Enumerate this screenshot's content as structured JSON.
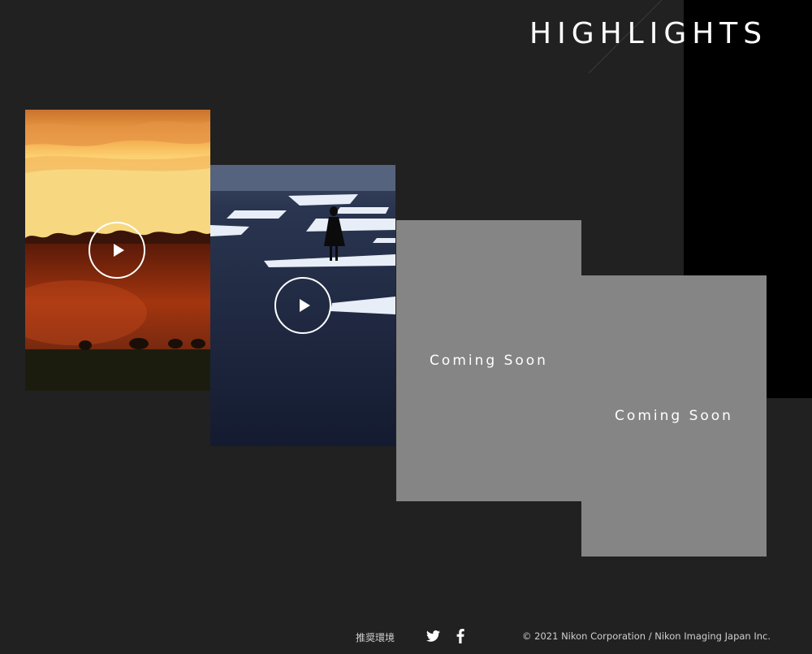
{
  "header": {
    "title": "HIGHLIGHTS"
  },
  "cards": [
    {
      "type": "video",
      "icon": "play-icon",
      "image": "sunset-savanna-elephants"
    },
    {
      "type": "video",
      "icon": "play-icon",
      "image": "person-on-illuminated-floor"
    },
    {
      "type": "placeholder",
      "label": "Coming Soon"
    },
    {
      "type": "placeholder",
      "label": "Coming Soon"
    }
  ],
  "footer": {
    "recommended_env": "推奨環境",
    "twitter_icon": "twitter-icon",
    "facebook_icon": "facebook-icon",
    "copyright": "© 2021 Nikon Corporation / Nikon Imaging Japan Inc."
  },
  "colors": {
    "background": "#212121",
    "panel": "#000000",
    "placeholder": "#858585",
    "text": "#ffffff"
  }
}
